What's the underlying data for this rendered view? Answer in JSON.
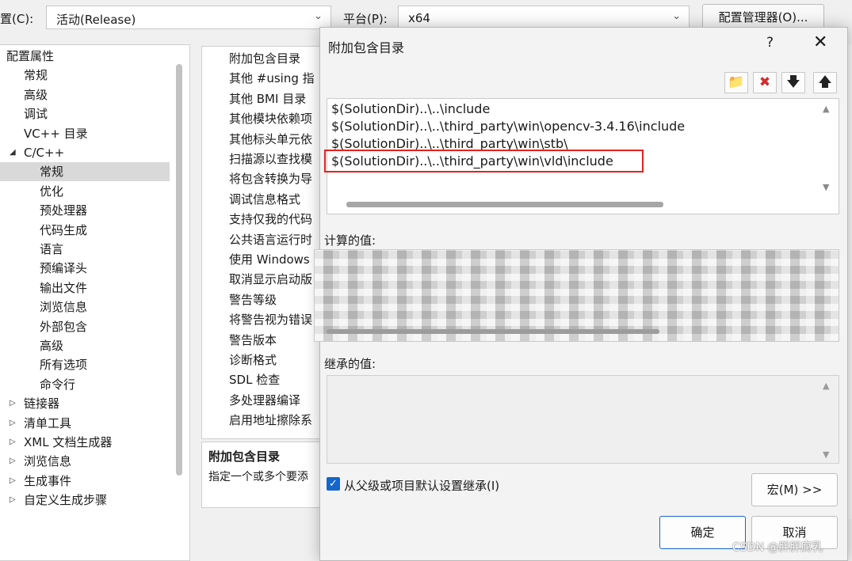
{
  "config_bar": {
    "config_label": "置(C):",
    "config_value": "活动(Release)",
    "platform_label": "平台(P):",
    "platform_value": "x64",
    "manager_button": "配置管理器(O)..."
  },
  "tree": {
    "items": [
      {
        "label": "配置属性",
        "indent": 0,
        "prefix": ""
      },
      {
        "label": "常规",
        "indent": 1,
        "prefix": ""
      },
      {
        "label": "高级",
        "indent": 1,
        "prefix": ""
      },
      {
        "label": "调试",
        "indent": 1,
        "prefix": ""
      },
      {
        "label": "VC++ 目录",
        "indent": 1,
        "prefix": ""
      },
      {
        "label": "C/C++",
        "indent": 1,
        "prefix": "◢"
      },
      {
        "label": "常规",
        "indent": 2,
        "prefix": "",
        "selected": true
      },
      {
        "label": "优化",
        "indent": 2,
        "prefix": ""
      },
      {
        "label": "预处理器",
        "indent": 2,
        "prefix": ""
      },
      {
        "label": "代码生成",
        "indent": 2,
        "prefix": ""
      },
      {
        "label": "语言",
        "indent": 2,
        "prefix": ""
      },
      {
        "label": "预编译头",
        "indent": 2,
        "prefix": ""
      },
      {
        "label": "输出文件",
        "indent": 2,
        "prefix": ""
      },
      {
        "label": "浏览信息",
        "indent": 2,
        "prefix": ""
      },
      {
        "label": "外部包含",
        "indent": 2,
        "prefix": ""
      },
      {
        "label": "高级",
        "indent": 2,
        "prefix": ""
      },
      {
        "label": "所有选项",
        "indent": 2,
        "prefix": ""
      },
      {
        "label": "命令行",
        "indent": 2,
        "prefix": ""
      },
      {
        "label": "链接器",
        "indent": 1,
        "prefix": "▷"
      },
      {
        "label": "清单工具",
        "indent": 1,
        "prefix": "▷"
      },
      {
        "label": "XML 文档生成器",
        "indent": 1,
        "prefix": "▷"
      },
      {
        "label": "浏览信息",
        "indent": 1,
        "prefix": "▷"
      },
      {
        "label": "生成事件",
        "indent": 1,
        "prefix": "▷"
      },
      {
        "label": "自定义生成步骤",
        "indent": 1,
        "prefix": "▷"
      }
    ]
  },
  "properties": {
    "items": [
      "附加包含目录",
      "其他 #using 指",
      "其他 BMI 目录",
      "其他模块依赖项",
      "其他标头单元依",
      "扫描源以查找模",
      "将包含转换为导",
      "调试信息格式",
      "支持仅我的代码",
      "公共语言运行时",
      "使用 Windows",
      "取消显示启动版",
      "警告等级",
      "将警告视为错误",
      "警告版本",
      "诊断格式",
      "SDL 检查",
      "多处理器编译",
      "启用地址擦除系"
    ],
    "desc_title": "附加包含目录",
    "desc_text": "指定一个或多个要添"
  },
  "dialog": {
    "title": "附加包含目录",
    "help": "?",
    "close": "✕",
    "toolbar": [
      {
        "name": "new-line-button",
        "icon": "folder-new-icon",
        "glyph": "📁",
        "color": "#d9a63a"
      },
      {
        "name": "delete-button",
        "icon": "delete-x-icon",
        "glyph": "✖",
        "color": "#d42b2b"
      },
      {
        "name": "move-down-button",
        "icon": "arrow-down-icon",
        "glyph": "🡇",
        "color": "#222222"
      },
      {
        "name": "move-up-button",
        "icon": "arrow-up-icon",
        "glyph": "🡅",
        "color": "#222222"
      }
    ],
    "lines": [
      "$(SolutionDir)..\\..\\include",
      "$(SolutionDir)..\\..\\third_party\\win\\opencv-3.4.16\\include",
      "$(SolutionDir)..\\..\\third_party\\win\\stb\\",
      "$(SolutionDir)..\\..\\third_party\\win\\vld\\include"
    ],
    "computed_label": "计算的值:",
    "inherited_label": "继承的值:",
    "inherit_checkbox_label": "从父级或项目默认设置继承(I)",
    "inherit_checked": true,
    "macros_button": "宏(M) >>",
    "ok_button": "确定",
    "cancel_button": "取消"
  },
  "watermark": "CSDN @胖胖腐乳",
  "colors": {
    "highlight": "#e32222",
    "checkbox": "#1466c8",
    "selected_row": "#d9d9d9"
  }
}
